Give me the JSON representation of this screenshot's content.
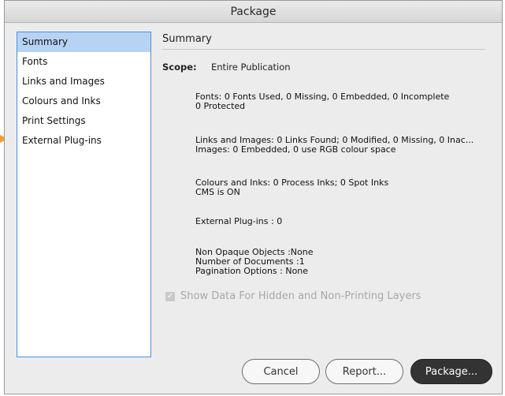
{
  "window": {
    "title": "Package"
  },
  "sidebar": {
    "items": [
      {
        "label": "Summary"
      },
      {
        "label": "Fonts"
      },
      {
        "label": "Links and Images"
      },
      {
        "label": "Colours and Inks"
      },
      {
        "label": "Print Settings"
      },
      {
        "label": "External Plug-ins"
      }
    ],
    "selected_index": 0
  },
  "summary": {
    "title": "Summary",
    "scope_label": "Scope:",
    "scope_value": "Entire Publication",
    "fonts": {
      "line1": "Fonts: 0 Fonts Used, 0 Missing, 0 Embedded, 0 Incomplete",
      "line2": "0 Protected"
    },
    "links": {
      "line1": "Links and Images: 0 Links Found; 0 Modified, 0 Missing, 0 Inac...",
      "line2": "Images: 0 Embedded, 0 use RGB colour space"
    },
    "colours": {
      "line1": "Colours and Inks: 0 Process Inks; 0 Spot Inks",
      "line2": "CMS is ON"
    },
    "plugins": {
      "line1": "External Plug-ins : 0"
    },
    "other": {
      "line1": "Non Opaque Objects :None",
      "line2": "Number of Documents :1",
      "line3": "Pagination Options : None"
    }
  },
  "options": {
    "show_hidden_label": "Show Data For Hidden and Non-Printing Layers",
    "show_hidden_checked": true,
    "show_hidden_enabled": false
  },
  "buttons": {
    "cancel": "Cancel",
    "report": "Report...",
    "package": "Package..."
  },
  "colors": {
    "accent_pointer": "#f0a030",
    "selection": "#b7d3f3",
    "primary_button": "#333333"
  }
}
